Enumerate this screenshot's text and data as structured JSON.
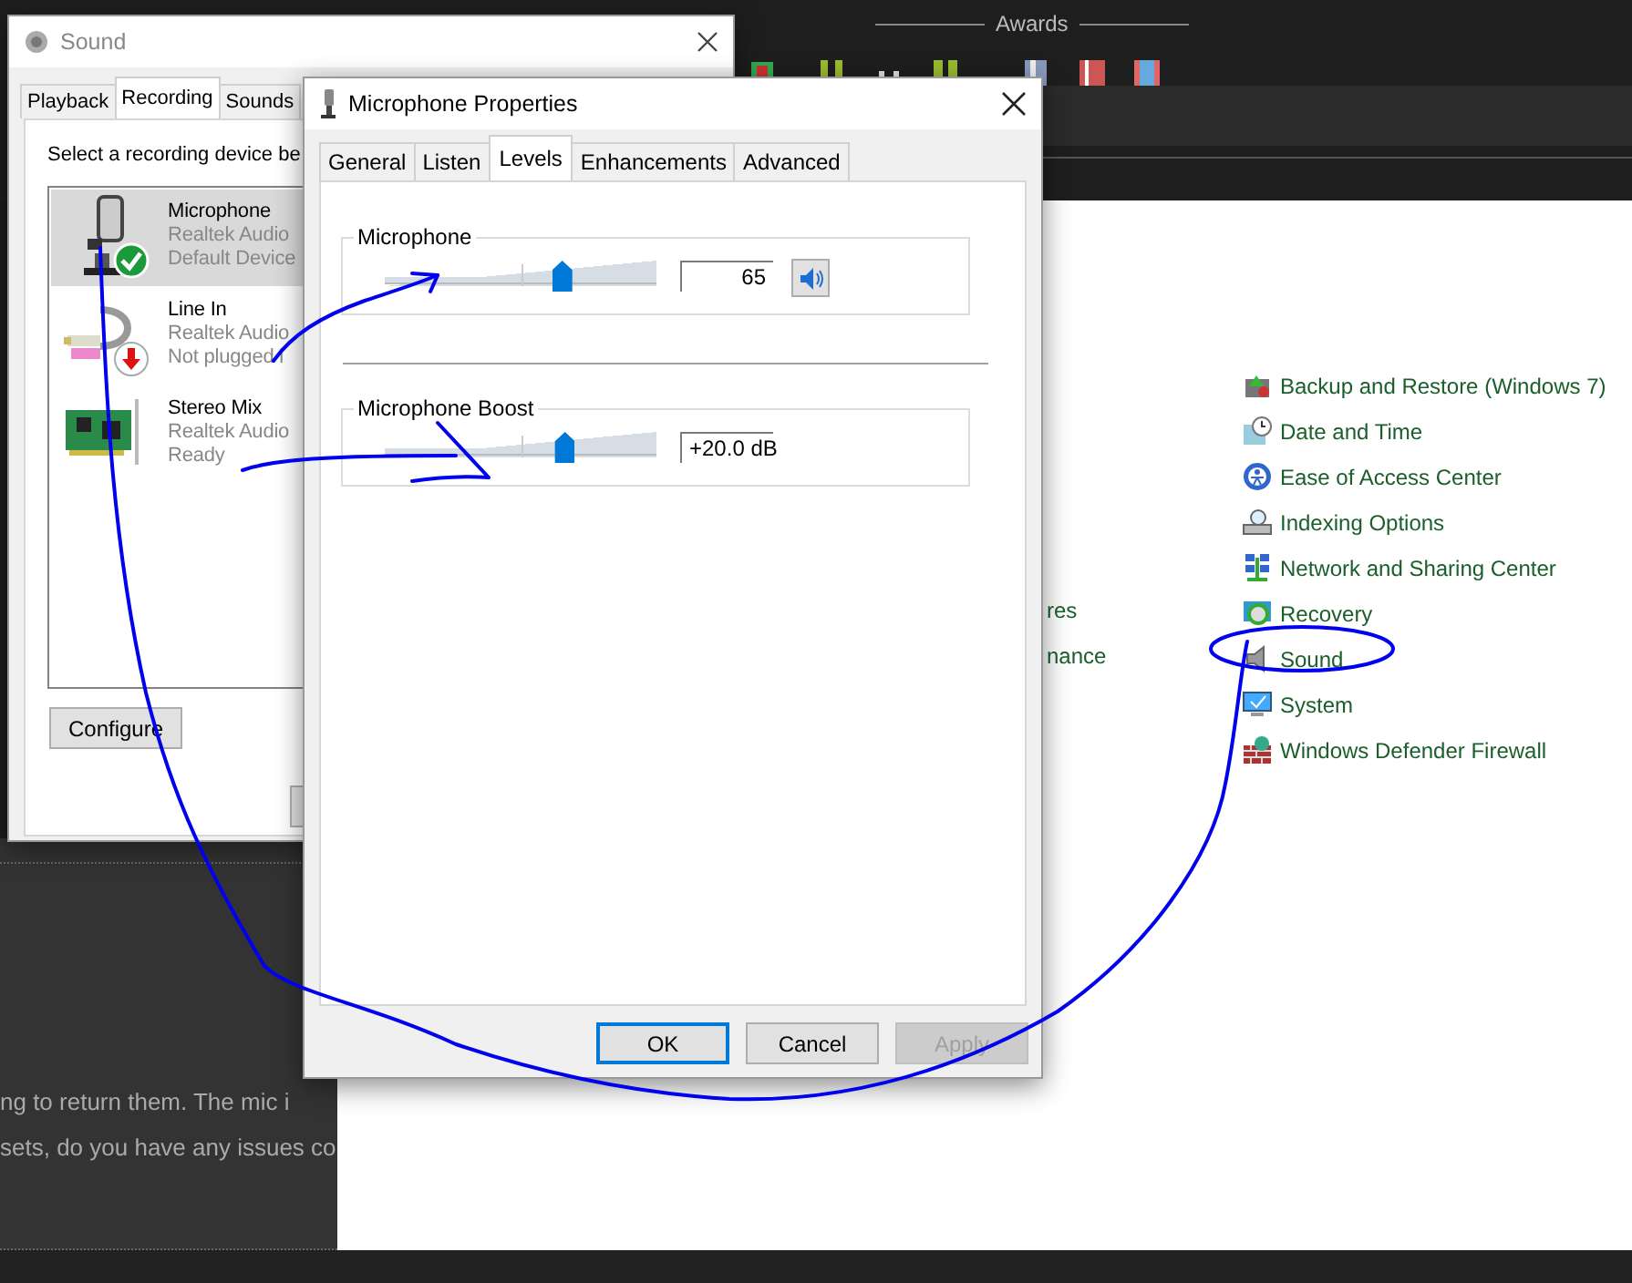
{
  "background": {
    "top_bar": {
      "heading": "Awards"
    },
    "forum_text": [
      "ng to return them. The mic i",
      "sets, do you have any issues co"
    ],
    "control_panel": {
      "cut_items": [
        "res",
        "nance"
      ],
      "items": [
        {
          "label": "Backup and Restore (Windows 7)",
          "kind": "backup"
        },
        {
          "label": "Date and Time",
          "kind": "clock"
        },
        {
          "label": "Ease of Access Center",
          "kind": "access"
        },
        {
          "label": "Indexing Options",
          "kind": "indexing"
        },
        {
          "label": "Network and Sharing Center",
          "kind": "network"
        },
        {
          "label": "Recovery",
          "kind": "recovery"
        },
        {
          "label": "Sound",
          "kind": "sound"
        },
        {
          "label": "System",
          "kind": "system"
        },
        {
          "label": "Windows Defender Firewall",
          "kind": "firewall"
        }
      ]
    }
  },
  "sound_window": {
    "title": "Sound",
    "tabs": [
      {
        "label": "Playback",
        "selected": false
      },
      {
        "label": "Recording",
        "selected": true
      },
      {
        "label": "Sounds",
        "selected": false
      }
    ],
    "instruction": "Select a recording device be",
    "devices": [
      {
        "name": "Microphone",
        "driver": "Realtek Audio",
        "status": "Default Device",
        "kind": "microphone",
        "is_default": true,
        "plugged_in": true,
        "selected": true
      },
      {
        "name": "Line In",
        "driver": "Realtek Audio",
        "status": "Not plugged i",
        "kind": "line-in",
        "is_default": false,
        "plugged_in": false,
        "selected": false
      },
      {
        "name": "Stereo Mix",
        "driver": "Realtek Audio",
        "status": "Ready",
        "kind": "stereo-mix",
        "is_default": false,
        "plugged_in": true,
        "selected": false
      }
    ],
    "buttons": [
      "Configure"
    ]
  },
  "properties_dialog": {
    "title": "Microphone Properties",
    "tabs": [
      {
        "label": "General",
        "selected": false
      },
      {
        "label": "Listen",
        "selected": false
      },
      {
        "label": "Levels",
        "selected": true
      },
      {
        "label": "Enhancements",
        "selected": false
      },
      {
        "label": "Advanced",
        "selected": false
      }
    ],
    "levels": [
      {
        "label": "Microphone",
        "kind": "volume",
        "level": 0.65,
        "reading": "65",
        "muted": false
      },
      {
        "label": "Microphone Boost",
        "kind": "boost",
        "level": 0.66,
        "reading": "+20.0 dB"
      }
    ],
    "buttons": [
      {
        "label": "OK",
        "default": true,
        "disabled": false
      },
      {
        "label": "Cancel",
        "default": false,
        "disabled": false
      },
      {
        "label": "Apply",
        "default": false,
        "disabled": true
      }
    ]
  }
}
